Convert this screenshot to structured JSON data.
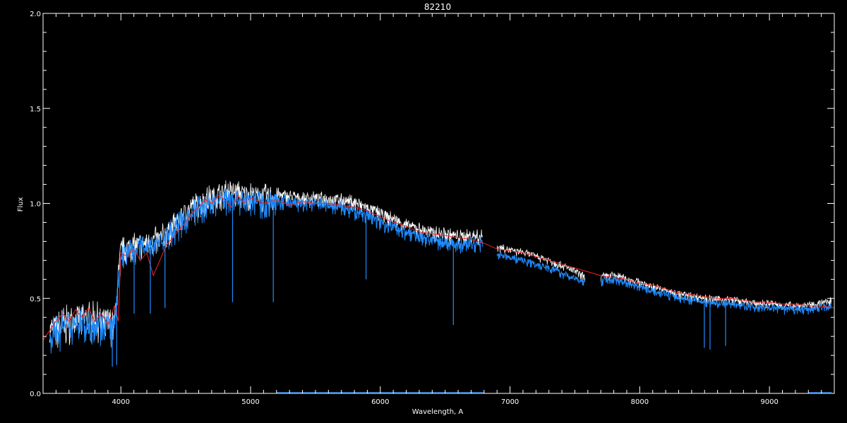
{
  "chart_data": {
    "type": "line",
    "title": "82210",
    "xlabel": "Wavelength, A",
    "ylabel": "Flux",
    "xlim": [
      3400,
      9500
    ],
    "ylim": [
      0.0,
      2.0
    ],
    "x_ticks": [
      4000,
      5000,
      6000,
      7000,
      8000,
      9000
    ],
    "x_tick_labels": [
      "4000",
      "5000",
      "6000",
      "7000",
      "8000",
      "9000"
    ],
    "y_ticks": [
      0.0,
      0.5,
      1.0,
      1.5,
      2.0
    ],
    "y_tick_labels": [
      "0.0",
      "0.5",
      "1.0",
      "1.5",
      "2.0"
    ],
    "grid": false,
    "colors": {
      "background": "#000000",
      "axes": "#ffffff",
      "observed": "#ffffff",
      "spectrum": "#1e8cff",
      "model": "#ff2020"
    },
    "series": [
      {
        "key": "observed",
        "style": "noisy",
        "x": [
          3450,
          3550,
          3650,
          3750,
          3850,
          3950,
          4000,
          4100,
          4200,
          4300,
          4400,
          4500,
          4600,
          4700,
          4800,
          4900,
          5000,
          5100,
          5200,
          5300,
          5400,
          5500,
          5600,
          5700,
          5800,
          5900,
          6000,
          6100,
          6200,
          6300,
          6400,
          6500,
          6600,
          6700,
          6790,
          null,
          6900,
          7000,
          7100,
          7200,
          7300,
          7400,
          7500,
          7580,
          null,
          7700,
          7800,
          7900,
          8000,
          8100,
          8200,
          8300,
          8400,
          8500,
          8600,
          8700,
          8800,
          8900,
          9000,
          9100,
          9200,
          9300,
          9400,
          9480
        ],
        "y": [
          0.36,
          0.4,
          0.42,
          0.43,
          0.42,
          0.4,
          0.78,
          0.8,
          0.82,
          0.84,
          0.9,
          0.98,
          1.03,
          1.06,
          1.08,
          1.08,
          1.07,
          1.06,
          1.06,
          1.05,
          1.04,
          1.04,
          1.04,
          1.03,
          1.02,
          0.99,
          0.96,
          0.93,
          0.9,
          0.88,
          0.86,
          0.85,
          0.84,
          0.84,
          0.84,
          null,
          0.78,
          0.76,
          0.75,
          0.73,
          0.71,
          0.68,
          0.65,
          0.62,
          null,
          0.62,
          0.63,
          0.61,
          0.59,
          0.57,
          0.55,
          0.53,
          0.52,
          0.51,
          0.5,
          0.5,
          0.49,
          0.48,
          0.48,
          0.47,
          0.47,
          0.47,
          0.48,
          0.5
        ]
      },
      {
        "key": "spectrum",
        "style": "noisy",
        "x": [
          3450,
          3550,
          3650,
          3750,
          3850,
          3950,
          4000,
          4100,
          4200,
          4300,
          4400,
          4500,
          4600,
          4700,
          4800,
          4900,
          5000,
          5100,
          5200,
          5300,
          5400,
          5500,
          5600,
          5700,
          5800,
          5900,
          6000,
          6100,
          6200,
          6300,
          6400,
          6500,
          6600,
          6700,
          6790,
          null,
          6900,
          7000,
          7100,
          7200,
          7300,
          7400,
          7500,
          7580,
          null,
          7700,
          7800,
          7900,
          8000,
          8100,
          8200,
          8300,
          8400,
          8500,
          8600,
          8700,
          8800,
          8900,
          9000,
          9100,
          9200,
          9300,
          9400,
          9480
        ],
        "y": [
          0.34,
          0.38,
          0.4,
          0.41,
          0.4,
          0.38,
          0.75,
          0.78,
          0.8,
          0.82,
          0.88,
          0.95,
          1.0,
          1.03,
          1.05,
          1.05,
          1.04,
          1.03,
          1.03,
          1.02,
          1.01,
          1.01,
          1.0,
          0.99,
          0.97,
          0.95,
          0.92,
          0.89,
          0.86,
          0.84,
          0.82,
          0.81,
          0.8,
          0.8,
          0.8,
          null,
          0.74,
          0.72,
          0.71,
          0.69,
          0.67,
          0.64,
          0.61,
          0.59,
          null,
          0.6,
          0.61,
          0.59,
          0.57,
          0.55,
          0.53,
          0.51,
          0.5,
          0.49,
          0.48,
          0.48,
          0.47,
          0.46,
          0.46,
          0.45,
          0.45,
          0.45,
          0.46,
          0.47
        ]
      },
      {
        "key": "model",
        "style": "smooth",
        "x": [
          3400,
          3450,
          3500,
          3550,
          3600,
          3650,
          3700,
          3750,
          3800,
          3850,
          3900,
          3950,
          3980,
          4000,
          4050,
          4100,
          4150,
          4200,
          4250,
          4300,
          4350,
          4400,
          4450,
          4500,
          4550,
          4600,
          4650,
          4700,
          4750,
          4800,
          4850,
          4900,
          4950,
          5000,
          5100,
          5200,
          5300,
          5400,
          5500,
          5600,
          5700,
          5800,
          5900,
          6000,
          6100,
          6200,
          6300,
          6400,
          6500,
          6600,
          6700,
          6800,
          6900,
          7000,
          7100,
          7200,
          7300,
          7400,
          7500,
          7600,
          7700,
          7800,
          7900,
          8000,
          8100,
          8200,
          8300,
          8400,
          8500,
          8600,
          8700,
          8800,
          8900,
          9000,
          9100,
          9200,
          9300,
          9400,
          9500
        ],
        "y": [
          0.28,
          0.33,
          0.38,
          0.42,
          0.38,
          0.44,
          0.4,
          0.45,
          0.38,
          0.42,
          0.36,
          0.46,
          0.38,
          0.74,
          0.72,
          0.76,
          0.7,
          0.74,
          0.62,
          0.7,
          0.78,
          0.82,
          0.86,
          0.9,
          0.95,
          0.98,
          1.02,
          1.0,
          1.04,
          1.02,
          0.98,
          1.04,
          1.0,
          1.03,
          1.0,
          1.02,
          0.99,
          1.01,
          1.0,
          1.0,
          0.99,
          0.98,
          0.96,
          0.93,
          0.9,
          0.88,
          0.85,
          0.84,
          0.83,
          0.82,
          0.81,
          0.79,
          0.76,
          0.75,
          0.74,
          0.72,
          0.7,
          0.68,
          0.66,
          0.64,
          0.62,
          0.61,
          0.6,
          0.58,
          0.57,
          0.55,
          0.53,
          0.52,
          0.51,
          0.5,
          0.5,
          0.49,
          0.48,
          0.48,
          0.47,
          0.47,
          0.46,
          0.46,
          0.45
        ]
      }
    ],
    "absorption_lines": [
      {
        "x": 3934,
        "y": 0.14
      },
      {
        "x": 3968,
        "y": 0.15
      },
      {
        "x": 4102,
        "y": 0.42
      },
      {
        "x": 4227,
        "y": 0.42
      },
      {
        "x": 4340,
        "y": 0.45
      },
      {
        "x": 4861,
        "y": 0.48
      },
      {
        "x": 5175,
        "y": 0.48
      },
      {
        "x": 5890,
        "y": 0.6
      },
      {
        "x": 6563,
        "y": 0.36
      },
      {
        "x": 8498,
        "y": 0.24
      },
      {
        "x": 8542,
        "y": 0.23
      },
      {
        "x": 8662,
        "y": 0.25
      }
    ]
  }
}
